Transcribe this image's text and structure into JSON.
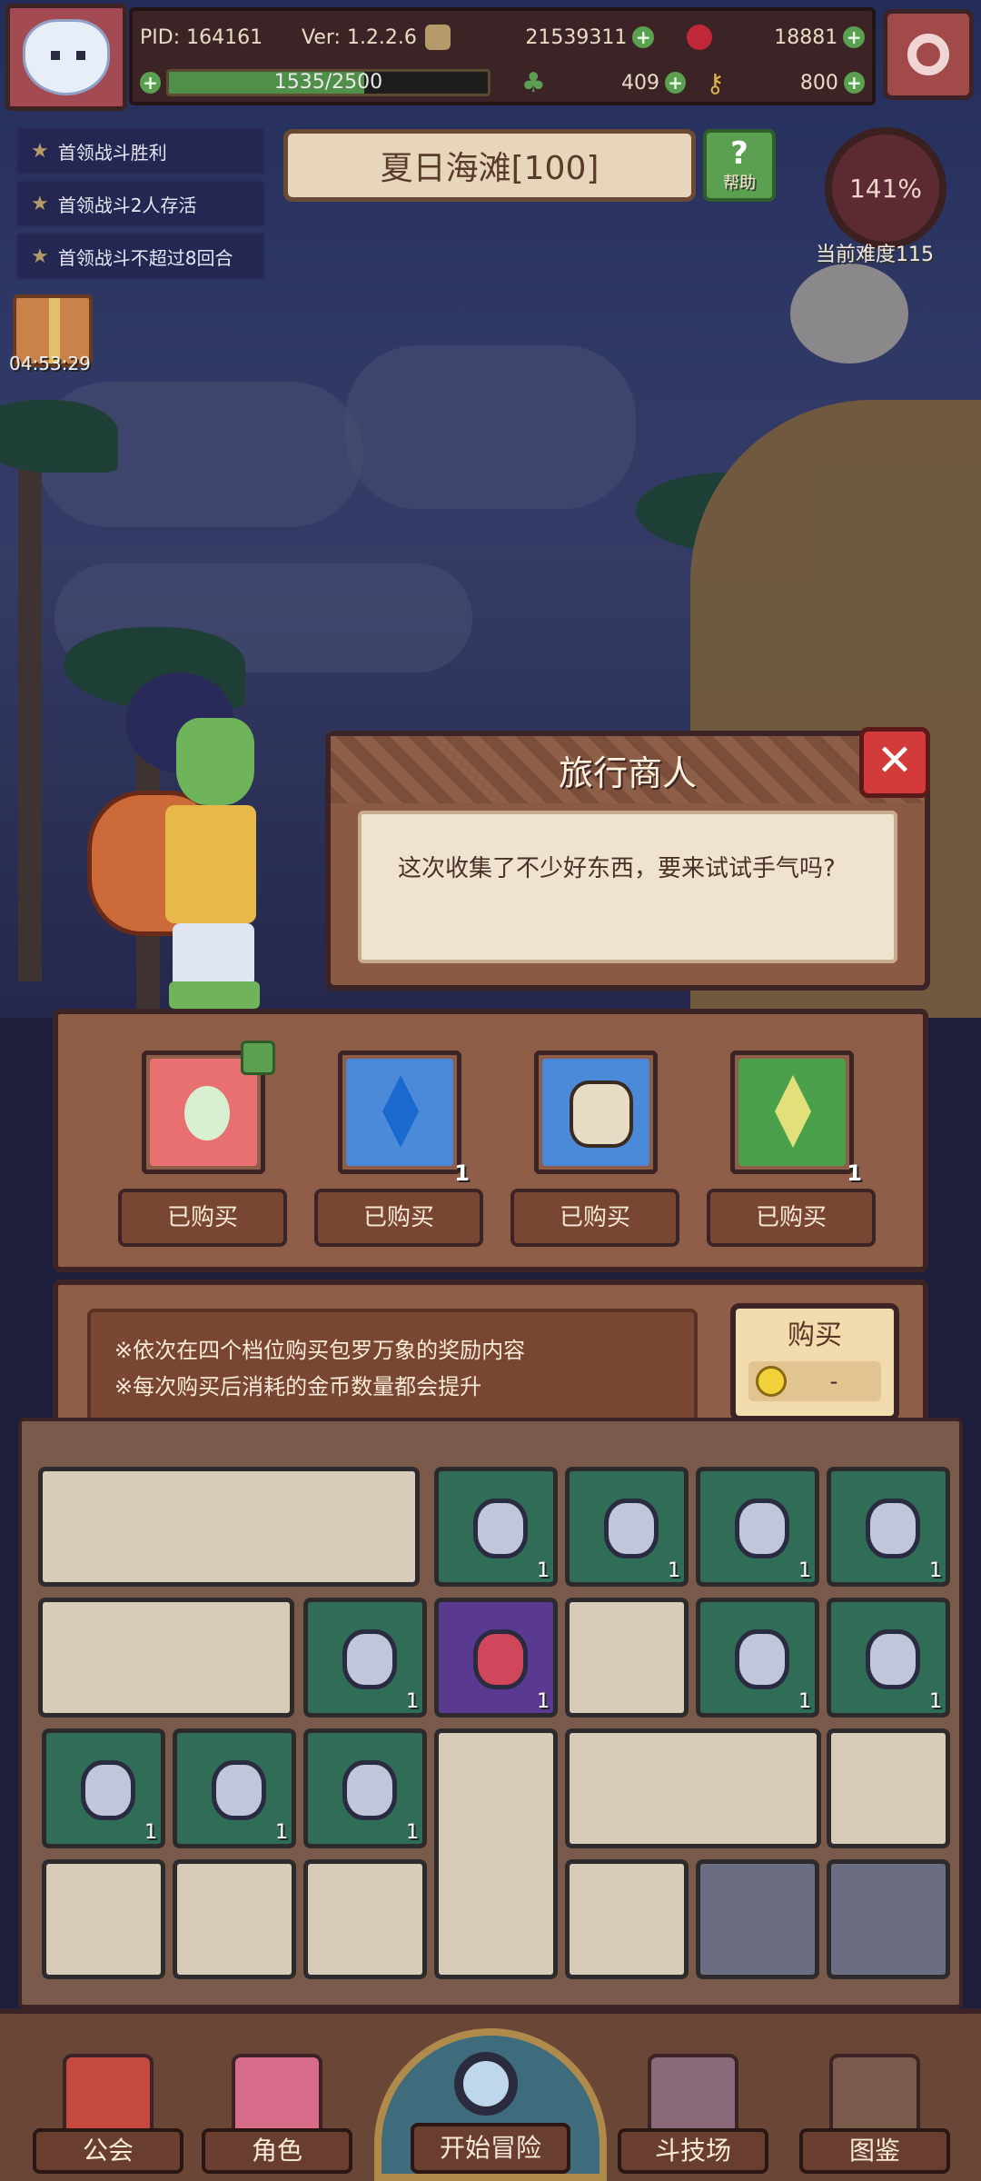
{
  "hud": {
    "pid": "PID: 164161",
    "version": "Ver: 1.2.2.6",
    "gold": "21539311",
    "gems": "18881",
    "xp_text": "1535/2500",
    "xp_progress": 0.614,
    "clover": "409",
    "keys": "800"
  },
  "quests": [
    "首领战斗胜利",
    "首领战斗2人存活",
    "首领战斗不超过8回合"
  ],
  "gift_timer": "04:53:29",
  "stage": {
    "title": "夏日海滩[100]",
    "help_label": "帮助",
    "difficulty_percent": "141%",
    "difficulty_label": "当前难度115"
  },
  "dialog": {
    "title": "旅行商人",
    "text": "这次收集了不少好东西，要来试试手气吗?"
  },
  "shop": {
    "slots": [
      {
        "name": "bulb-item",
        "count": "",
        "status": "已购买",
        "color": "#e87070"
      },
      {
        "name": "blue-crystal",
        "count": "1",
        "status": "已购买",
        "color": "#4a8ad8"
      },
      {
        "name": "stone-relic",
        "count": "",
        "status": "已购买",
        "color": "#4a8ad8"
      },
      {
        "name": "green-crystal",
        "count": "1",
        "status": "已购买",
        "color": "#4aa04a"
      }
    ],
    "info_lines": [
      "※依次在四个档位购买包罗万象的奖励内容",
      "※每次购买后消耗的金币数量都会提升"
    ],
    "buy_label": "购买",
    "buy_cost": "-"
  },
  "inventory_counts": [
    "1",
    "1",
    "1",
    "1",
    "1",
    "1",
    "1",
    "1",
    "1",
    "1",
    "1"
  ],
  "nav": {
    "guild": "公会",
    "character": "角色",
    "adventure": "开始冒险",
    "arena": "斗技场",
    "codex": "图鉴"
  }
}
